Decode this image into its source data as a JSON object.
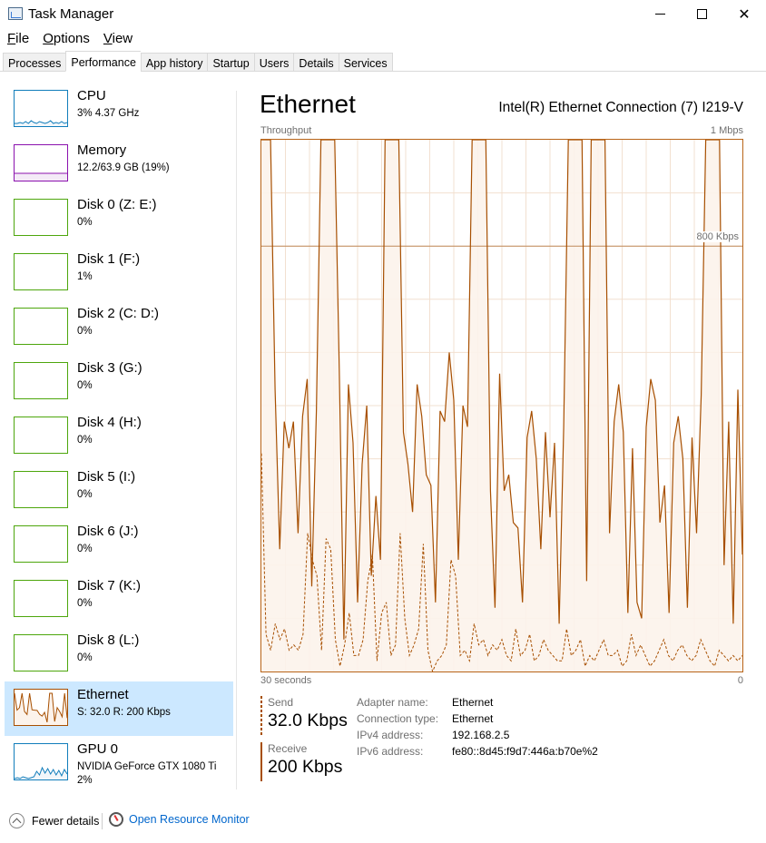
{
  "window": {
    "title": "Task Manager"
  },
  "menu": [
    {
      "key": "F",
      "rest": "ile"
    },
    {
      "key": "O",
      "rest": "ptions"
    },
    {
      "key": "V",
      "rest": "iew"
    }
  ],
  "tabs": [
    "Processes",
    "Performance",
    "App history",
    "Startup",
    "Users",
    "Details",
    "Services"
  ],
  "active_tab": "Performance",
  "sidebar": [
    {
      "name": "CPU",
      "sub": "3%  4.37 GHz",
      "color": "#117dbb",
      "fill": "#f1f6fa"
    },
    {
      "name": "Memory",
      "sub": "12.2/63.9 GB (19%)",
      "color": "#8b12ae",
      "fill": "#f4eaf7"
    },
    {
      "name": "Disk 0 (Z: E:)",
      "sub": "0%",
      "color": "#4da60c",
      "fill": "#eff7ea"
    },
    {
      "name": "Disk 1 (F:)",
      "sub": "1%",
      "color": "#4da60c",
      "fill": "#eff7ea"
    },
    {
      "name": "Disk 2 (C: D:)",
      "sub": "0%",
      "color": "#4da60c",
      "fill": "#eff7ea"
    },
    {
      "name": "Disk 3 (G:)",
      "sub": "0%",
      "color": "#4da60c",
      "fill": "#eff7ea"
    },
    {
      "name": "Disk 4 (H:)",
      "sub": "0%",
      "color": "#4da60c",
      "fill": "#eff7ea"
    },
    {
      "name": "Disk 5 (I:)",
      "sub": "0%",
      "color": "#4da60c",
      "fill": "#eff7ea"
    },
    {
      "name": "Disk 6 (J:)",
      "sub": "0%",
      "color": "#4da60c",
      "fill": "#eff7ea"
    },
    {
      "name": "Disk 7 (K:)",
      "sub": "0%",
      "color": "#4da60c",
      "fill": "#eff7ea"
    },
    {
      "name": "Disk 8 (L:)",
      "sub": "0%",
      "color": "#4da60c",
      "fill": "#eff7ea"
    },
    {
      "name": "Ethernet",
      "sub": "S: 32.0  R: 200 Kbps",
      "color": "#a74f01",
      "fill": "#fcf3eb"
    },
    {
      "name": "GPU 0",
      "sub": "NVIDIA GeForce GTX 1080 Ti",
      "sub2": "2%",
      "color": "#117dbb",
      "fill": "#f1f6fa"
    }
  ],
  "selected_sidebar": "Ethernet",
  "main": {
    "title": "Ethernet",
    "adapter": "Intel(R) Ethernet Connection (7) I219-V",
    "graph_label": "Throughput",
    "graph_max": "1 Mbps",
    "graph_scale_line": "800 Kbps",
    "time_left": "30 seconds",
    "time_right": "0",
    "send_label": "Send",
    "send_value": "32.0 Kbps",
    "receive_label": "Receive",
    "receive_value": "200 Kbps",
    "details": [
      {
        "key": "Adapter name:",
        "value": "Ethernet"
      },
      {
        "key": "Connection type:",
        "value": "Ethernet"
      },
      {
        "key": "IPv4 address:",
        "value": "192.168.2.5"
      },
      {
        "key": "IPv6 address:",
        "value": "fe80::8d45:f9d7:446a:b70e%2"
      }
    ]
  },
  "footer": {
    "fewer_details": "Fewer details",
    "resource_monitor": "Open Resource Monitor"
  },
  "colors": {
    "ethernet_line": "#a74f01",
    "ethernet_fill": "#fcf3eb",
    "selected_bg": "#cce8ff",
    "link": "#0066cc"
  },
  "chart_data": {
    "type": "area",
    "ylim_kbps": [
      0,
      1000
    ],
    "xlim_seconds": [
      30,
      0
    ],
    "receive_kbps": [
      1000,
      1000,
      1000,
      530,
      230,
      470,
      420,
      470,
      260,
      480,
      550,
      160,
      490,
      1000,
      1000,
      1000,
      1000,
      570,
      60,
      540,
      430,
      130,
      390,
      500,
      180,
      330,
      210,
      1000,
      1000,
      1000,
      1000,
      450,
      390,
      300,
      540,
      480,
      370,
      350,
      130,
      490,
      470,
      600,
      510,
      210,
      500,
      460,
      1000,
      1000,
      1000,
      1000,
      340,
      120,
      560,
      340,
      370,
      280,
      270,
      130,
      440,
      490,
      400,
      230,
      450,
      290,
      430,
      90,
      460,
      1000,
      1000,
      1000,
      1000,
      170,
      1000,
      1000,
      1000,
      1000,
      260,
      470,
      540,
      450,
      110,
      420,
      130,
      100,
      460,
      550,
      510,
      280,
      350,
      110,
      430,
      480,
      400,
      120,
      440,
      260,
      520,
      1000,
      1000,
      1000,
      1000,
      200,
      470,
      90,
      530,
      220
    ],
    "send_kbps": [
      410,
      70,
      40,
      90,
      60,
      80,
      40,
      50,
      40,
      70,
      260,
      210,
      180,
      40,
      250,
      230,
      60,
      10,
      50,
      110,
      30,
      30,
      60,
      170,
      220,
      20,
      110,
      130,
      30,
      50,
      260,
      100,
      30,
      50,
      80,
      240,
      40,
      0,
      20,
      30,
      50,
      210,
      180,
      30,
      40,
      20,
      90,
      50,
      60,
      30,
      50,
      40,
      60,
      30,
      20,
      80,
      30,
      40,
      70,
      20,
      30,
      60,
      40,
      30,
      20,
      20,
      80,
      30,
      40,
      60,
      10,
      30,
      20,
      40,
      60,
      30,
      30,
      40,
      10,
      20,
      70,
      30,
      50,
      30,
      10,
      20,
      40,
      60,
      30,
      20,
      40,
      50,
      30,
      20,
      30,
      60,
      40,
      20,
      10,
      40,
      30,
      20,
      30,
      20,
      30
    ]
  }
}
